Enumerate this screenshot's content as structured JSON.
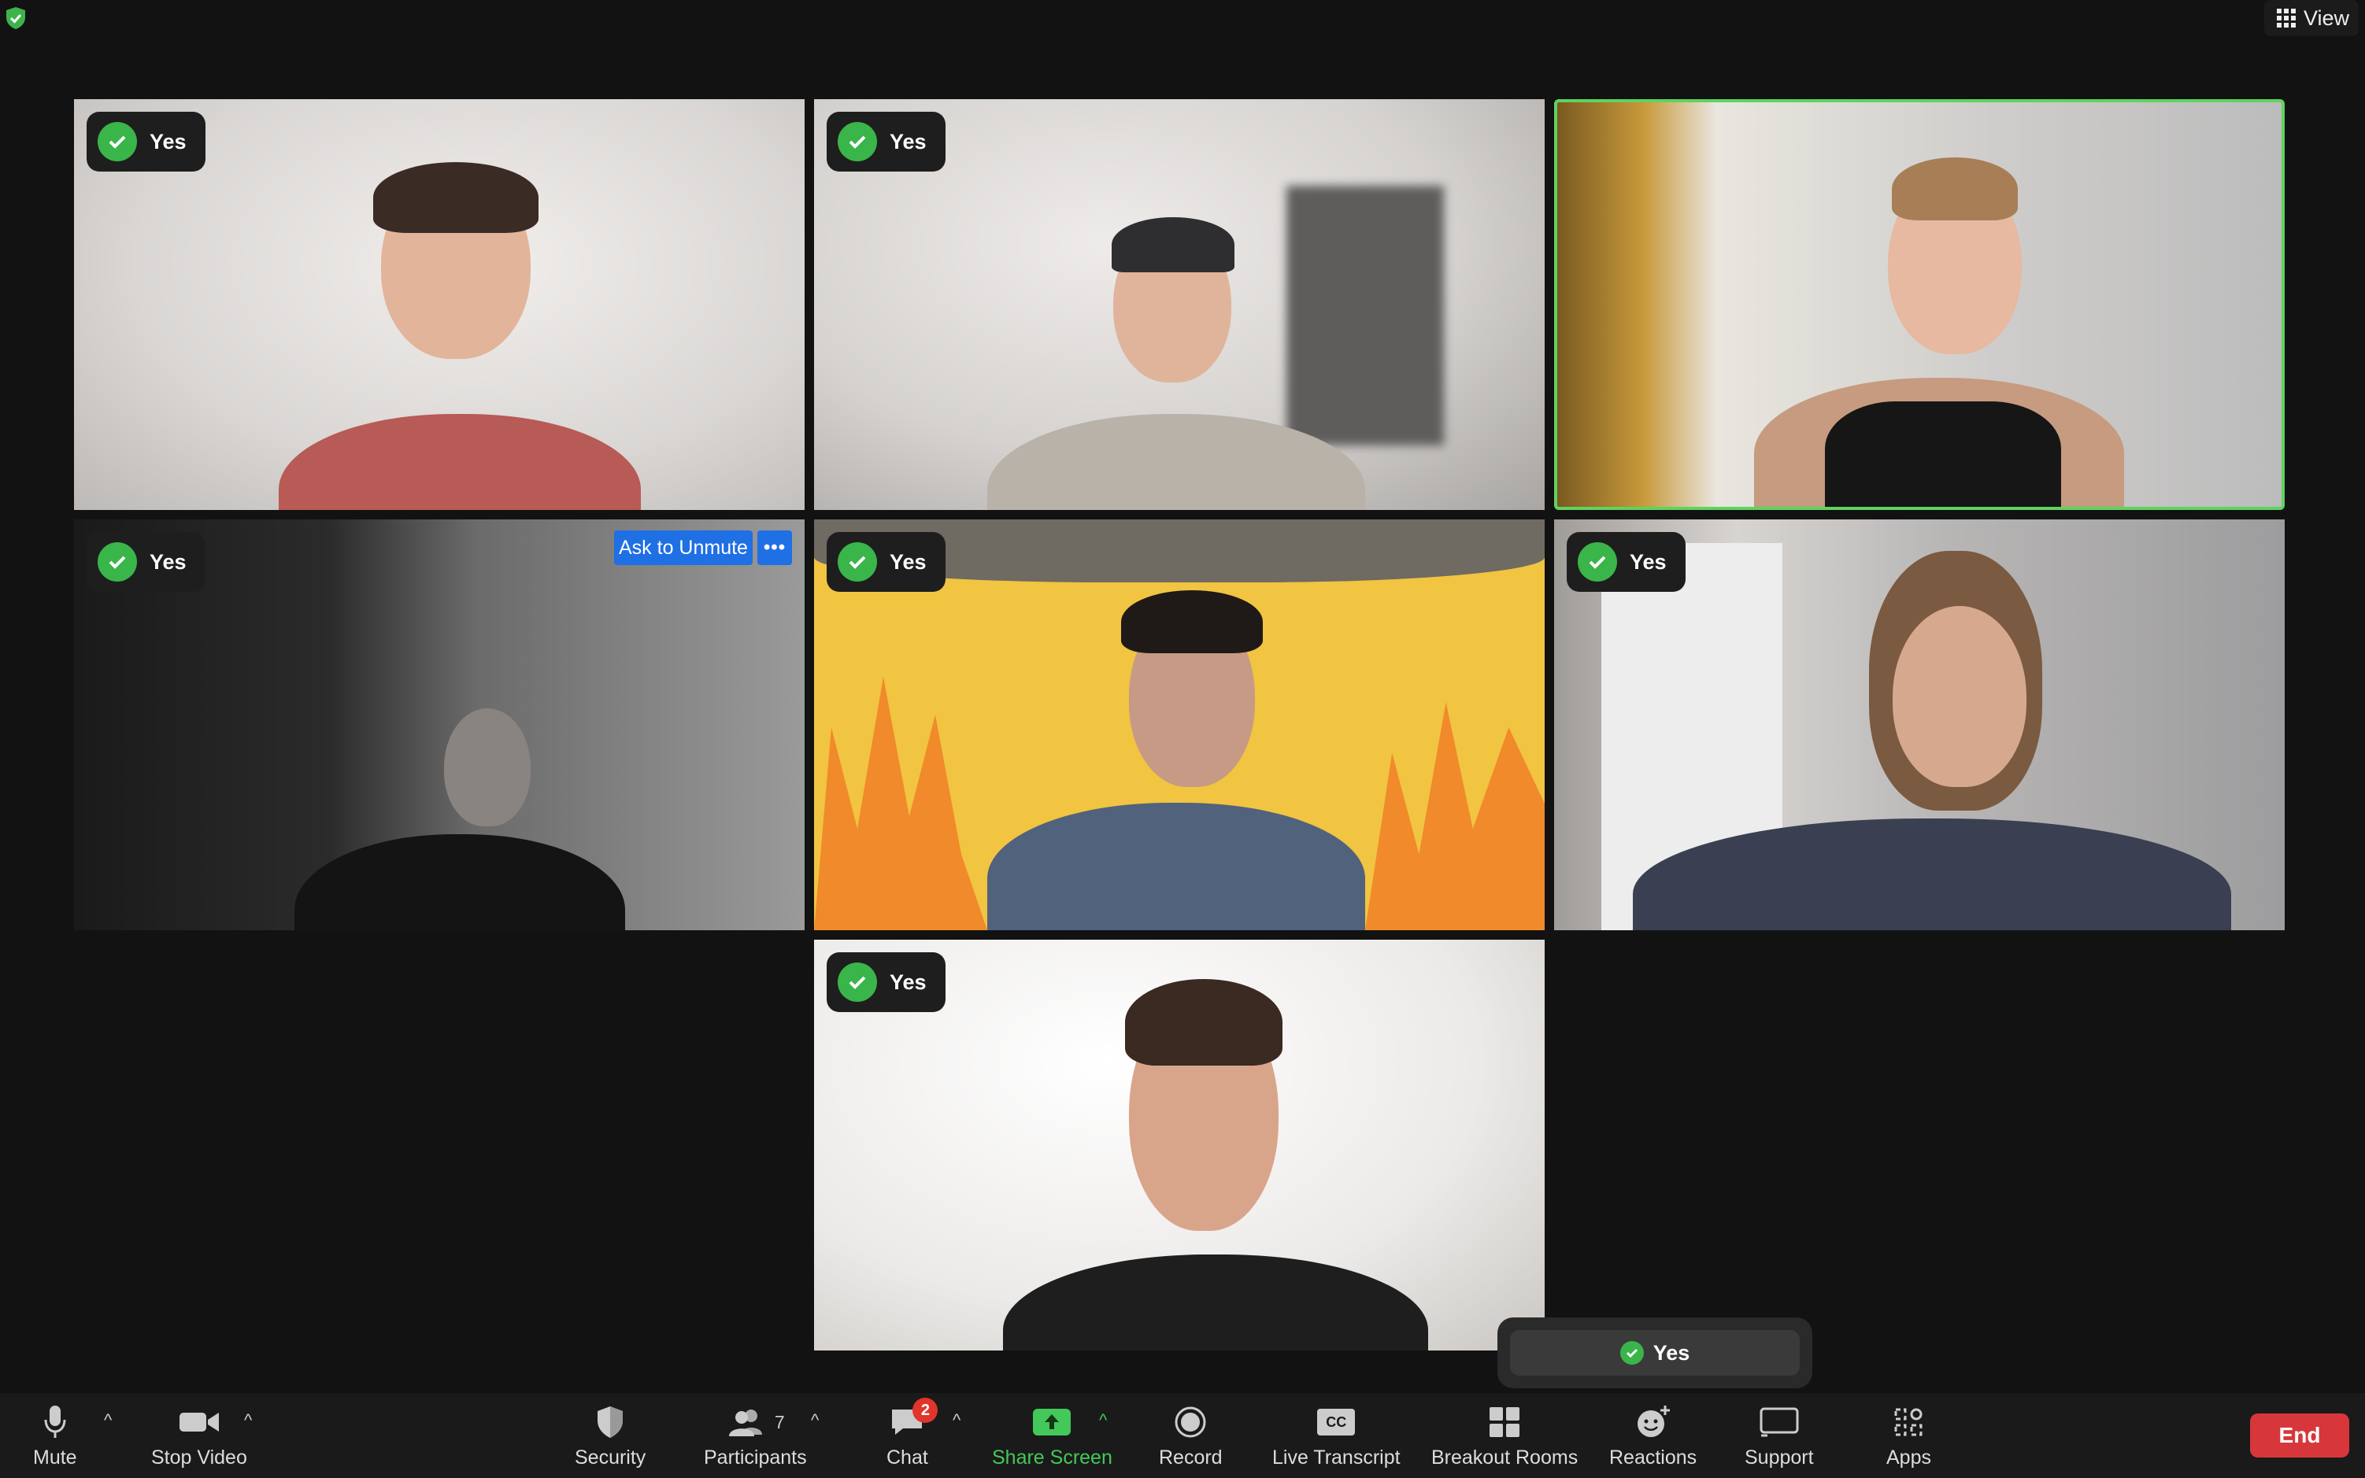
{
  "top_bar": {
    "shield_icon": "shield-check-icon",
    "view_label": "View"
  },
  "colors": {
    "background": "#121212",
    "toolbar": "#1a1a1a",
    "yes_green": "#39b54a",
    "speaking_border": "#5fd35f",
    "ask_blue": "#1f6fe5",
    "share_green": "#43c85a",
    "end_red": "#d7373a",
    "badge_red": "#e0352b"
  },
  "participants": [
    {
      "status": "Yes"
    },
    {
      "status": "Yes"
    },
    {
      "status": "",
      "speaking": true
    },
    {
      "status": "Yes",
      "ask_unmute_label": "Ask to Unmute",
      "more_label": "•••"
    },
    {
      "status": "Yes"
    },
    {
      "status": "Yes"
    },
    {
      "status": "Yes"
    }
  ],
  "poll_popup": {
    "label": "Yes"
  },
  "toolbar": {
    "mute": "Mute",
    "stop_video": "Stop Video",
    "security": "Security",
    "participants": "Participants",
    "participants_count": "7",
    "chat": "Chat",
    "chat_badge": "2",
    "share_screen": "Share Screen",
    "record": "Record",
    "live_transcript": "Live Transcript",
    "breakout_rooms": "Breakout Rooms",
    "reactions": "Reactions",
    "support": "Support",
    "apps": "Apps",
    "end": "End",
    "caret": "^",
    "cc_text": "CC"
  }
}
